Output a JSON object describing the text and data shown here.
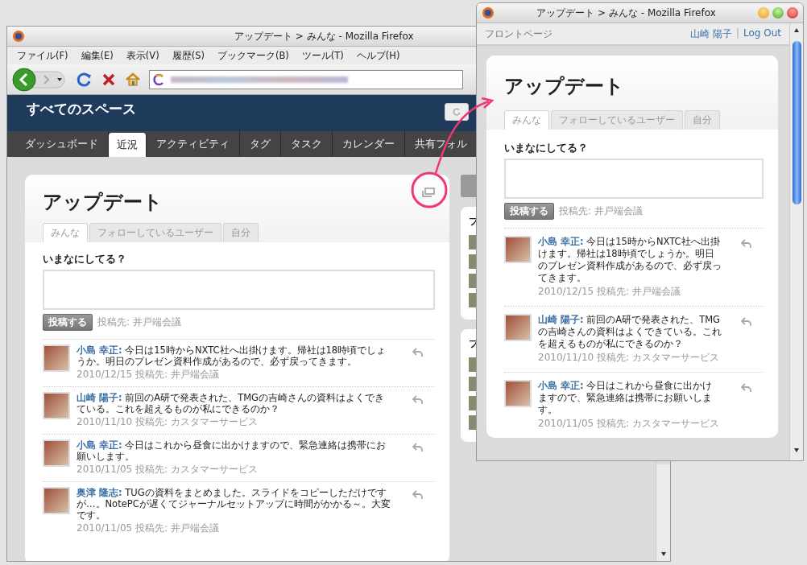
{
  "main_window": {
    "title": "アップデート > みんな - Mozilla Firefox",
    "menu": [
      "ファイル(F)",
      "編集(E)",
      "表示(V)",
      "履歴(S)",
      "ブックマーク(B)",
      "ツール(T)",
      "ヘルプ(H)"
    ],
    "space_title": "すべてのスペース",
    "nav_tabs": [
      {
        "label": "ダッシュボード",
        "selected": false
      },
      {
        "label": "近況",
        "selected": true
      },
      {
        "label": "アクティビティ",
        "selected": false
      },
      {
        "label": "タグ",
        "selected": false
      },
      {
        "label": "タスク",
        "selected": false
      },
      {
        "label": "カレンダー",
        "selected": false
      },
      {
        "label": "共有フォル",
        "selected": false
      }
    ],
    "card": {
      "title": "アップデート",
      "tabs": [
        {
          "label": "みんな",
          "selected": true
        },
        {
          "label": "フォローしているユーザー",
          "selected": false
        },
        {
          "label": "自分",
          "selected": false
        }
      ],
      "prompt": "いまなにしてる？",
      "post_button": "投稿する",
      "post_target": "投稿先: 井戸端会議",
      "posts": [
        {
          "author": "小島 幸正:",
          "text": "今日は15時からNXTC社へ出掛けます。帰社は18時頃でしょうか。明日のプレゼン資料作成があるので、必ず戻ってきます。",
          "meta": "2010/12/15 投稿先: 井戸端会議"
        },
        {
          "author": "山崎 陽子:",
          "text": "前回のA研で発表された、TMGの吉崎さんの資料はよくできている。これを超えるものが私にできるのか？",
          "meta": "2010/11/10 投稿先: カスタマーサービス"
        },
        {
          "author": "小島 幸正:",
          "text": "今日はこれから昼食に出かけますので、緊急連絡は携帯にお願いします。",
          "meta": "2010/11/05 投稿先: カスタマーサービス"
        },
        {
          "author": "奥津 隆志:",
          "text": "TUGの資料をまとめました。スライドをコピーしただけですが…。NotePCが遅くてジャーナルセットアップに時間がかかる～。大変です。",
          "meta": "2010/11/05 投稿先: 井戸端会議"
        }
      ]
    },
    "sidebar_panels": [
      {
        "title": "フ"
      },
      {
        "title": "フ"
      }
    ]
  },
  "popup_window": {
    "title": "アップデート > みんな - Mozilla Firefox",
    "home_link": "フロントページ",
    "user_link": "山崎 陽子",
    "separator": "|",
    "logout_link": "Log Out",
    "card": {
      "title": "アップデート",
      "tabs": [
        {
          "label": "みんな",
          "selected": true
        },
        {
          "label": "フォローしているユーザー",
          "selected": false
        },
        {
          "label": "自分",
          "selected": false
        }
      ],
      "prompt": "いまなにしてる？",
      "post_button": "投稿する",
      "post_target": "投稿先: 井戸端会議",
      "posts": [
        {
          "author": "小島 幸正:",
          "text": "今日は15時からNXTC社へ出掛けます。帰社は18時頃でしょうか。明日のプレゼン資料作成があるので、必ず戻ってきます。",
          "meta": "2010/12/15 投稿先: 井戸端会議"
        },
        {
          "author": "山崎 陽子:",
          "text": "前回のA研で発表された、TMGの吉崎さんの資料はよくできている。これを超えるものが私にできるのか？",
          "meta": "2010/11/10 投稿先: カスタマーサービス"
        },
        {
          "author": "小島 幸正:",
          "text": "今日はこれから昼食に出かけますので、緊急連絡は携帯にお願いします。",
          "meta": "2010/11/05 投稿先: カスタマーサービス"
        }
      ]
    }
  }
}
